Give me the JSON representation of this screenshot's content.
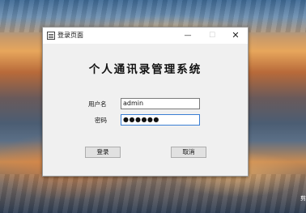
{
  "window": {
    "title": "登录页面",
    "controls": {
      "minimize": "—",
      "maximize": "☐",
      "close": "✕"
    }
  },
  "form": {
    "heading": "个人通讯录管理系统",
    "username_label": "用户名",
    "username_value": "admin",
    "password_label": "密码",
    "password_value": "●●●●●●"
  },
  "buttons": {
    "login": "登录",
    "cancel": "取消"
  },
  "desktop": {
    "edge_text": "剪"
  }
}
